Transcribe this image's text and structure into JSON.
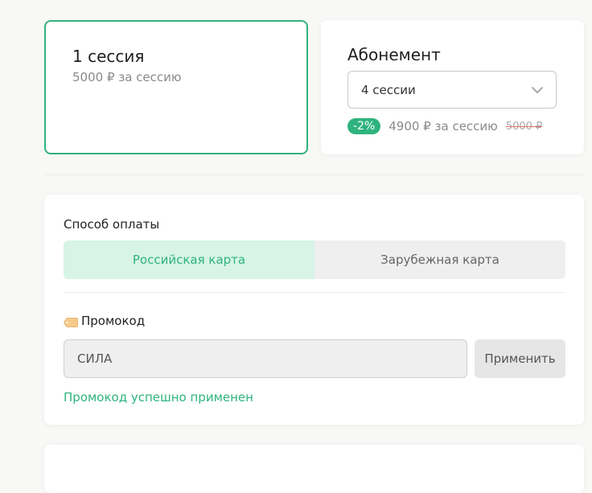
{
  "plans": {
    "single": {
      "title": "1 сессия",
      "price": "5000 ₽ за сессию",
      "selected": true
    },
    "subscription": {
      "title": "Абонемент",
      "select_value": "4 сессии",
      "discount_badge": "-2%",
      "price": "4900 ₽ за сессию",
      "old_price": "5000 ₽"
    }
  },
  "payment": {
    "heading": "Способ оплаты",
    "tabs": [
      {
        "label": "Российская карта",
        "active": true
      },
      {
        "label": "Зарубежная карта",
        "active": false
      }
    ]
  },
  "promo": {
    "label": "Промокод",
    "icon": "tag-icon",
    "input_value": "СИЛА",
    "apply_label": "Применить",
    "success_message": "Промокод успешно применен"
  },
  "colors": {
    "accent": "#2fb37e",
    "accent_light": "#d7f4e6",
    "background": "#f8f8f6"
  }
}
